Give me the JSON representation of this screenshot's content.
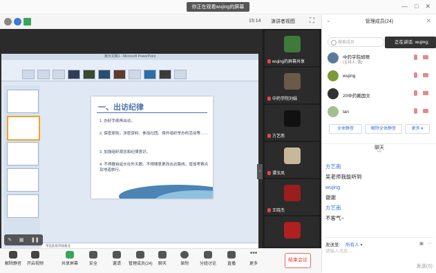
{
  "window": {
    "banner": "你正在观看wujing的屏幕",
    "controls": [
      "—",
      "□",
      "✕"
    ]
  },
  "toolbar_top": {
    "time": "15:14",
    "view_label": "演讲者视图",
    "fullscreen": "⛶"
  },
  "ppt": {
    "title": "演示文稿1 - Microsoft PowerPoint",
    "slide_heading": "一、出访纪律",
    "bullets": [
      "1. 办好手续再出访。",
      "2. 保密原则。涉密资料、参加社团、境外组织举办的活动等……",
      "3. 加强组织观念和纪律意识。",
      "4. 不得擅自延长在外天数。不得随意更改出访路线，增加考察点及地道旅行。"
    ],
    "notes": "单击此处添加备注"
  },
  "video_tiles": [
    {
      "name": "wujing的屏幕共享",
      "color": "#3f7a3a"
    },
    {
      "name": "中药学院刘娟",
      "color": "#6b5a4a"
    },
    {
      "name": "方艺南",
      "color": "#222222"
    },
    {
      "name": "谭玉凤",
      "color": "#c8b89a"
    },
    {
      "name": "王晓杰",
      "color": "#9a1e1e"
    },
    {
      "name": "",
      "color": "#b02020"
    }
  ],
  "bottom_bar": [
    {
      "label": "解除静音"
    },
    {
      "label": "开启视频"
    },
    {
      "label": "共享屏幕"
    },
    {
      "label": "安全"
    },
    {
      "label": "邀请"
    },
    {
      "label": "管理成员(24)"
    },
    {
      "label": "聊天"
    },
    {
      "label": "录制"
    },
    {
      "label": "分组讨论"
    },
    {
      "label": "直播"
    },
    {
      "label": "更多"
    }
  ],
  "end_meeting": "结束会议",
  "panel": {
    "title": "管理成员(24)",
    "close": "✕",
    "search_placeholder": "搜索成员",
    "speaking_tip": "正在讲话: wujing;",
    "members": [
      {
        "name": "中药学院胡晴",
        "role": "(主持人, 我)",
        "color": "#5a7a9a"
      },
      {
        "name": "wujing",
        "role": "",
        "color": "#7a9a3a"
      },
      {
        "name": "20中药戴国文",
        "role": "",
        "color": "#333333"
      },
      {
        "name": "tan",
        "role": "",
        "color": "#a0c090"
      }
    ],
    "btn_mute_all": "全体静音",
    "btn_unmute_all": "解除全体静音",
    "btn_more": "更多 ▾"
  },
  "chat": {
    "title": "聊天",
    "messages": [
      {
        "sender": "方艺南",
        "text": "吴老师我能听到"
      },
      {
        "sender": "wujing",
        "text": "谢谢"
      },
      {
        "sender": "方艺南",
        "text": "不客气~"
      }
    ],
    "send_to_label": "发送至:",
    "send_to_value": "所有人 ▾",
    "input_placeholder": "请输入消息...",
    "send_button": "发送(S)"
  }
}
